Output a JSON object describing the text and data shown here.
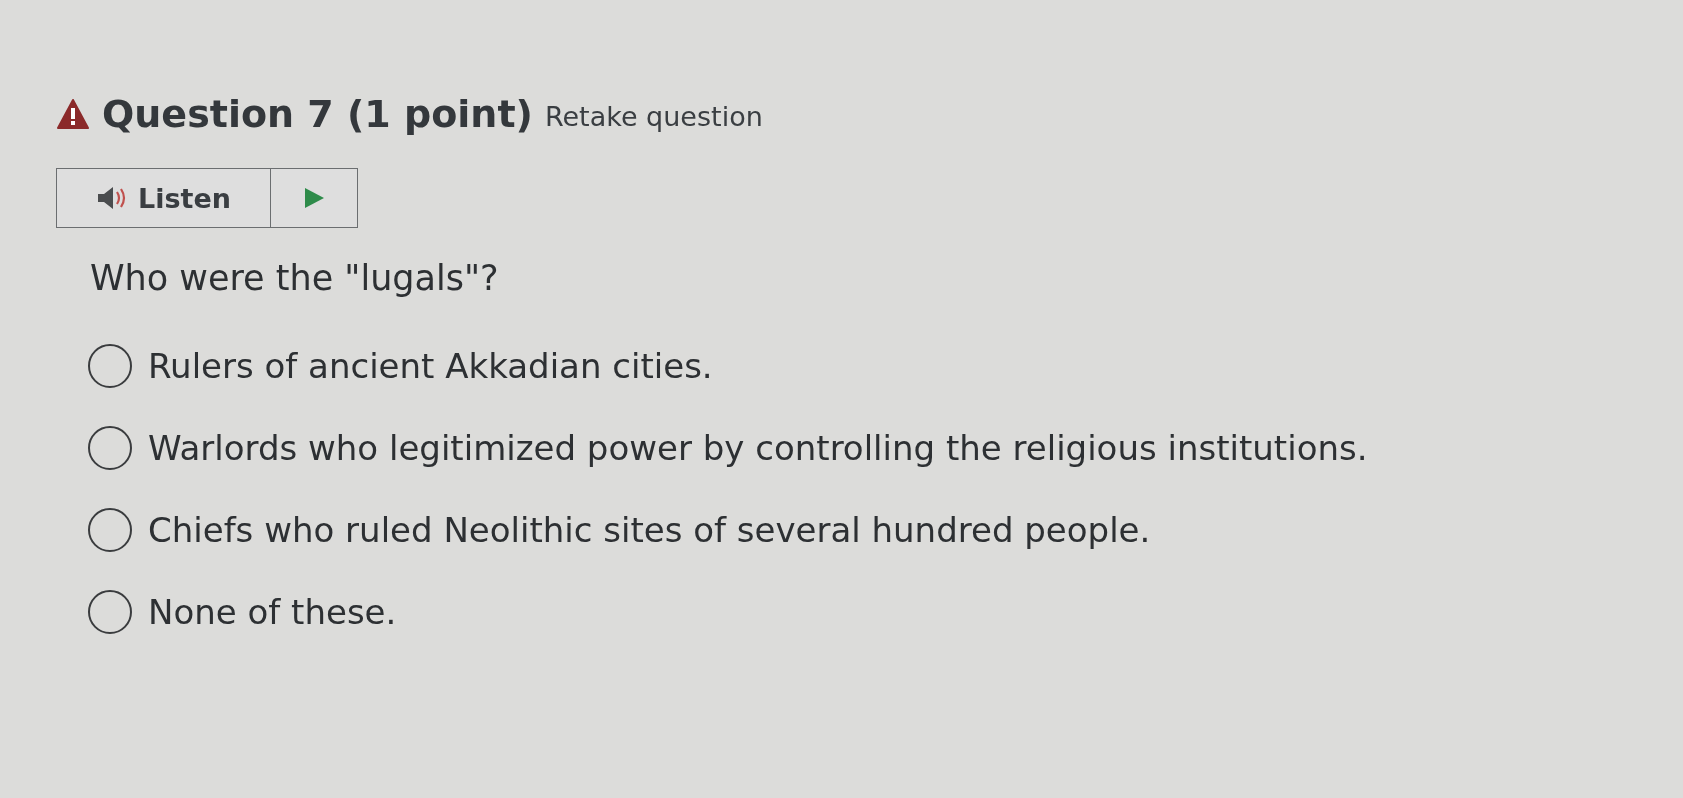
{
  "header": {
    "title": "Question 7 (1 point)",
    "link": "Retake question"
  },
  "listen": {
    "label": "Listen"
  },
  "question": "Who were the \"lugals\"?",
  "options": [
    {
      "label": "Rulers of ancient Akkadian cities.",
      "selected": false
    },
    {
      "label": "Warlords who legitimized power by controlling the religious institutions.",
      "selected": false
    },
    {
      "label": "Chiefs who ruled Neolithic sites of several hundred people.",
      "selected": false
    },
    {
      "label": "None of these.",
      "selected": false
    }
  ]
}
